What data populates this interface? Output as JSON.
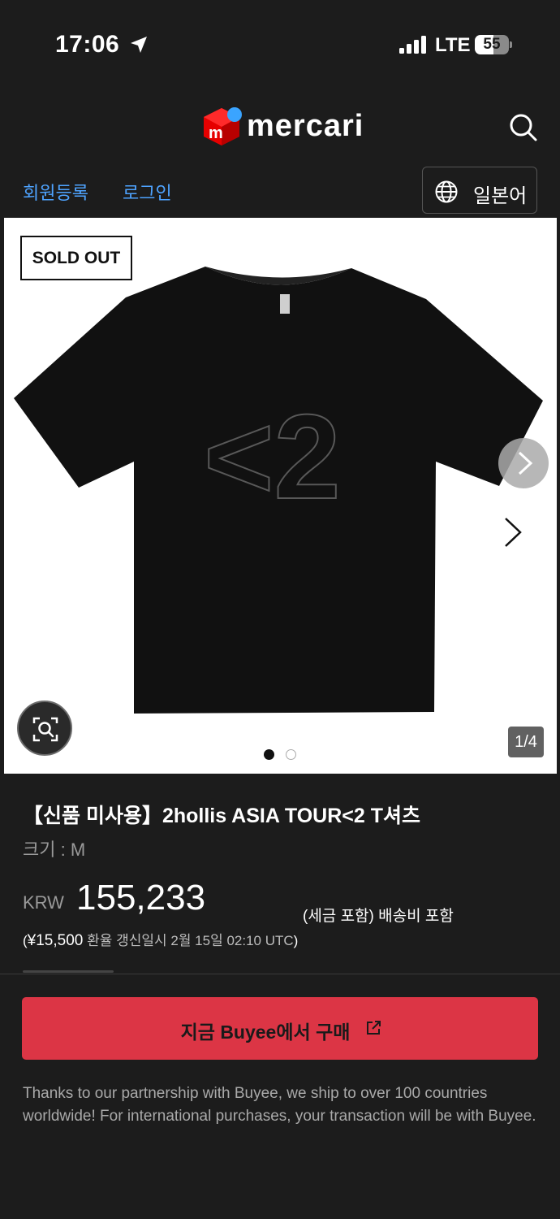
{
  "status_bar": {
    "time": "17:06",
    "network": "LTE",
    "battery": "55"
  },
  "header": {
    "logo_text": "mercari",
    "logo_mark_letter": "m",
    "brand_color": "#e60000",
    "search_icon": "search-icon"
  },
  "auth": {
    "register_label": "회원등록",
    "login_label": "로그인",
    "language_label": "일본어",
    "language_icon": "globe-icon"
  },
  "gallery": {
    "sold_out_label": "SOLD OUT",
    "counter": "1/4",
    "active_dot": 1,
    "dot_count": 2,
    "print_text": "<2"
  },
  "product": {
    "title": "【신품 미사용】2hollis ASIA TOUR<2 T셔츠",
    "size": "크기 : M",
    "currency": "KRW",
    "price": "155,233",
    "tax_note": "(세금 포함) 배송비 포함",
    "yen_open": "(",
    "yen_price": "¥15,500",
    "yen_rest": " 환율 갱신일시 2월 15일 02:10 UTC",
    "yen_close": ")"
  },
  "purchase": {
    "buy_label": "지금 Buyee에서 구매",
    "buy_color": "#dc3545",
    "partner_note": "Thanks to our partnership with Buyee, we ship to over 100 countries worldwide! For international purchases, your transaction will be with Buyee."
  }
}
